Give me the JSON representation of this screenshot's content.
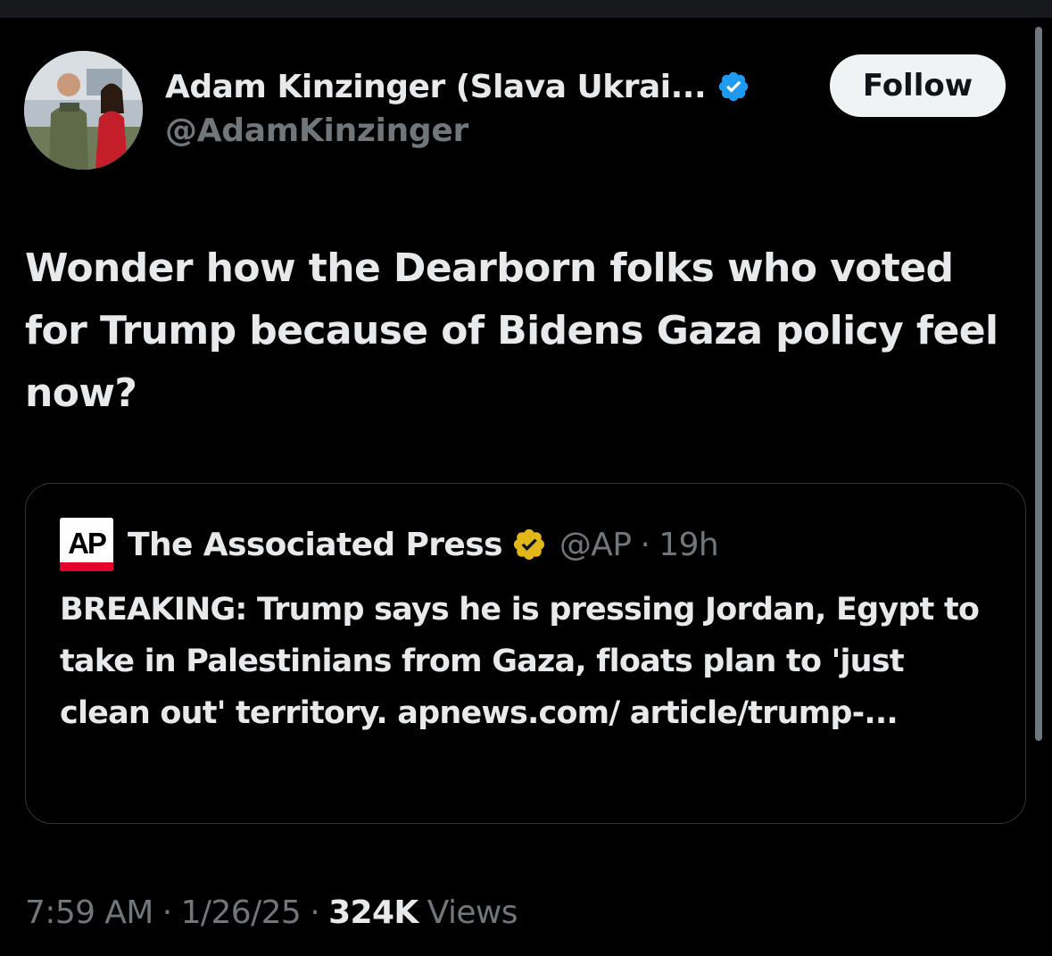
{
  "author": {
    "display_name": "Adam Kinzinger (Slava Ukrai...",
    "handle": "@AdamKinzinger",
    "avatar_icon": "profile-photo",
    "verified_icon": "verified-blue-badge-icon"
  },
  "follow_button": {
    "label": "Follow"
  },
  "tweet": {
    "text": "Wonder how the Dearborn folks who voted for Trump because of Bidens Gaza policy feel now?"
  },
  "quoted_tweet": {
    "logo_text": "AP",
    "logo_icon": "ap-logo",
    "display_name": "The Associated Press",
    "verified_icon": "verified-gold-badge-icon",
    "handle": "@AP",
    "separator": "·",
    "time": "19h",
    "text": "BREAKING: Trump says he is pressing Jordan, Egypt to take in Palestinians from Gaza, floats plan to 'just clean out' territory. apnews.com/ article/trump-..."
  },
  "meta": {
    "time": "7:59 AM",
    "separator": "·",
    "date": "1/26/25",
    "views_count": "324K",
    "views_label": "Views"
  },
  "colors": {
    "background": "#000000",
    "text_primary": "#e7e9ea",
    "text_secondary": "#71767b",
    "verified_blue": "#1d9bf0",
    "verified_gold": "#e2b719",
    "ap_red": "#e4002b",
    "border": "#2f3336",
    "button_bg": "#eff3f4"
  }
}
